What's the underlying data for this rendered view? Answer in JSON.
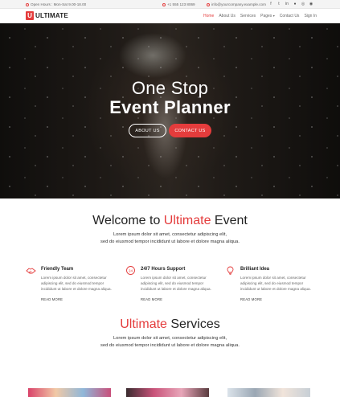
{
  "topbar": {
    "hours": "Open Hours : Mon-Sat 9.00-18.00",
    "phone": "+1 555 123 8069",
    "email": "info@yourcompany.example.com",
    "social": [
      "f",
      "t",
      "in",
      "●",
      "◎",
      "◉"
    ]
  },
  "brand": {
    "logo_letter": "U",
    "name": "ULTIMATE"
  },
  "nav": {
    "home": "Home",
    "about": "About Us",
    "services": "Services",
    "pages": "Pages",
    "contact": "Contact Us",
    "signin": "Sign In"
  },
  "hero": {
    "line1": "One Stop",
    "line2": "Event Planner",
    "about_button": "ABOUT US",
    "contact_button": "CONTACT US"
  },
  "welcome": {
    "title_pre": "Welcome to ",
    "title_accent": "Ultimate",
    "title_post": " Event",
    "line1": "Lorem ipsum dolor sit amet, consectetur adipiscing elit,",
    "line2": "sed do eiusmod tempor incididunt ut labore et dolore magna aliqua."
  },
  "features": [
    {
      "icon": "handshake-icon",
      "title": "Friendly Team",
      "text": "Lorem ipsum dolor sit amet, consectetur adipiscing elit, sed do eiusmod tempor incididunt ut labore et dolore magna aliqua.",
      "more": "READ MORE"
    },
    {
      "icon": "support-24-7-icon",
      "title": "24/7 Hours Support",
      "text": "Lorem ipsum dolor sit amet, consectetur adipiscing elit, sed do eiusmod tempor incididunt ut labore et dolore magna aliqua.",
      "more": "READ MORE"
    },
    {
      "icon": "lightbulb-icon",
      "title": "Brilliant Idea",
      "text": "Lorem ipsum dolor sit amet, consectetur adipiscing elit, sed do eiusmod tempor incididunt ut labore et dolore magna aliqua.",
      "more": "READ MORE"
    }
  ],
  "services": {
    "title_accent": "Ultimate",
    "title_post": " Services",
    "line1": "Lorem ipsum dolor sit amet, consectetur adipiscing elit,",
    "line2": "sed do eiusmod tempor incididunt ut labore et dolore magna aliqua."
  },
  "colors": {
    "accent": "#e43c3c",
    "text": "#333333",
    "topbar_bg": "#f4f4f4"
  }
}
